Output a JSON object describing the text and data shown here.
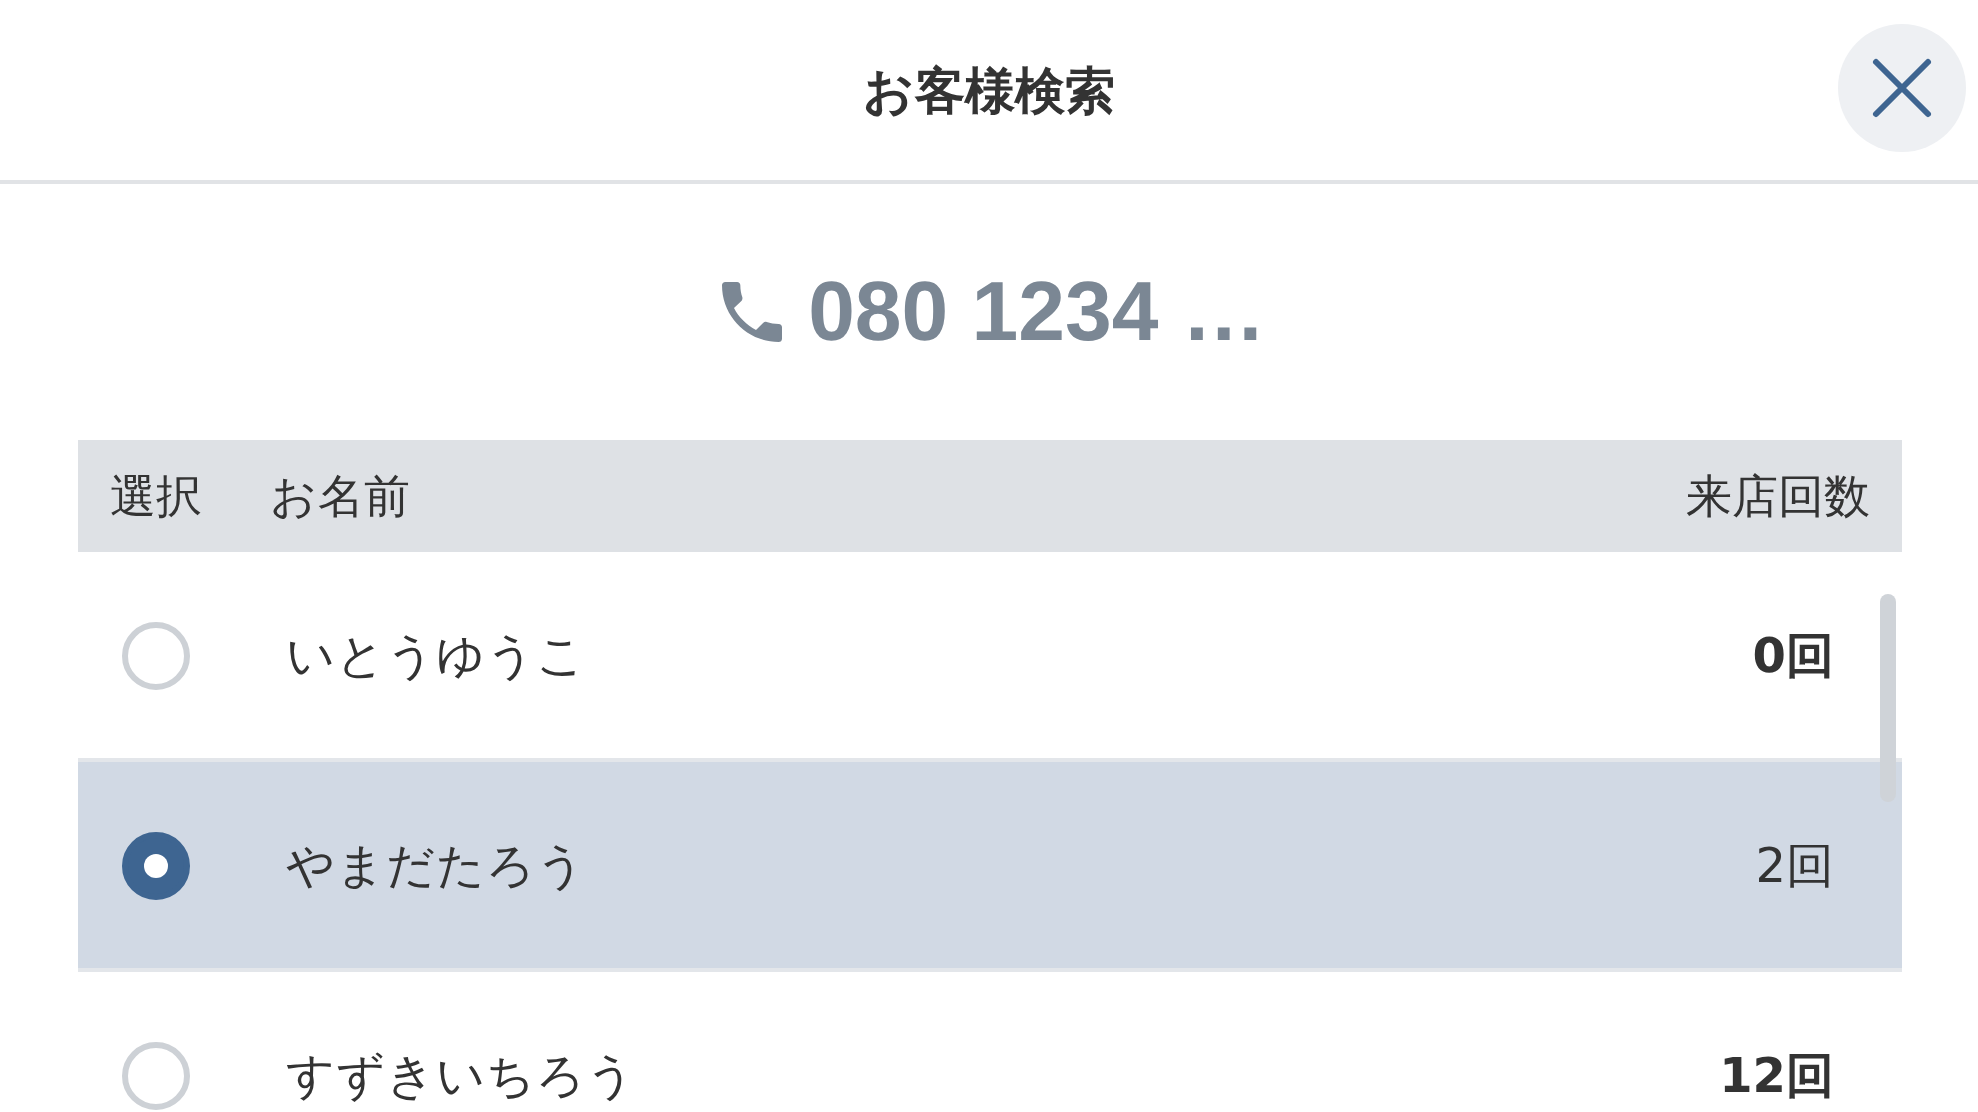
{
  "dialog": {
    "title": "お客様検索"
  },
  "phone": {
    "number": "080 1234 …"
  },
  "table": {
    "columns": [
      "選択",
      "お名前",
      "来店回数"
    ],
    "rows": [
      {
        "name": "いとうゆうこ",
        "visits": "0回",
        "selected": false
      },
      {
        "name": "やまだたろう",
        "visits": "2回",
        "selected": true
      },
      {
        "name": "すずきいちろう",
        "visits": "12回",
        "selected": false
      }
    ]
  }
}
